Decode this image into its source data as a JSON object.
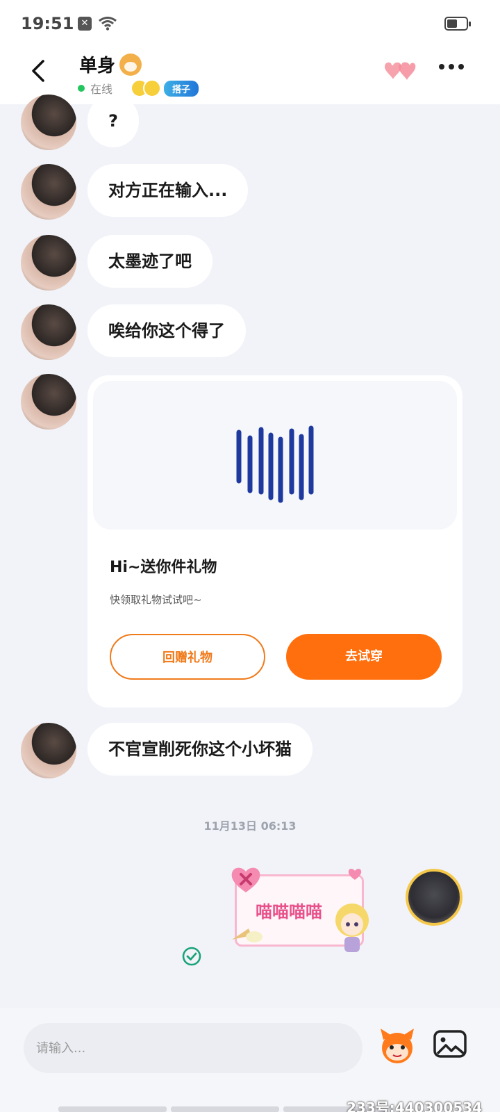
{
  "status_bar": {
    "time": "19:51",
    "battery_fraction": 0.55
  },
  "header": {
    "title": "单身",
    "online_status": "在线",
    "tag": "搭子"
  },
  "messages": [
    {
      "text": "?"
    },
    {
      "text": "对方正在输入..."
    },
    {
      "text": "太墨迹了吧"
    },
    {
      "text": "唉给你这个得了"
    },
    {
      "text": "不官宣削死你这个小坏猫"
    }
  ],
  "gift_card": {
    "title": "Hi~送你件礼物",
    "subtitle": "快领取礼物试试吧~",
    "return_button": "回赠礼物",
    "try_button": "去试穿"
  },
  "timestamp": "11月13日 06:13",
  "sticker": {
    "text": "喵喵喵喵"
  },
  "input_bar": {
    "placeholder": "请输入..."
  },
  "footer_watermark": "233号:440300534",
  "colors": {
    "accent": "#ff6f0d",
    "online": "#22c55e",
    "background": "#f1f3f8"
  }
}
